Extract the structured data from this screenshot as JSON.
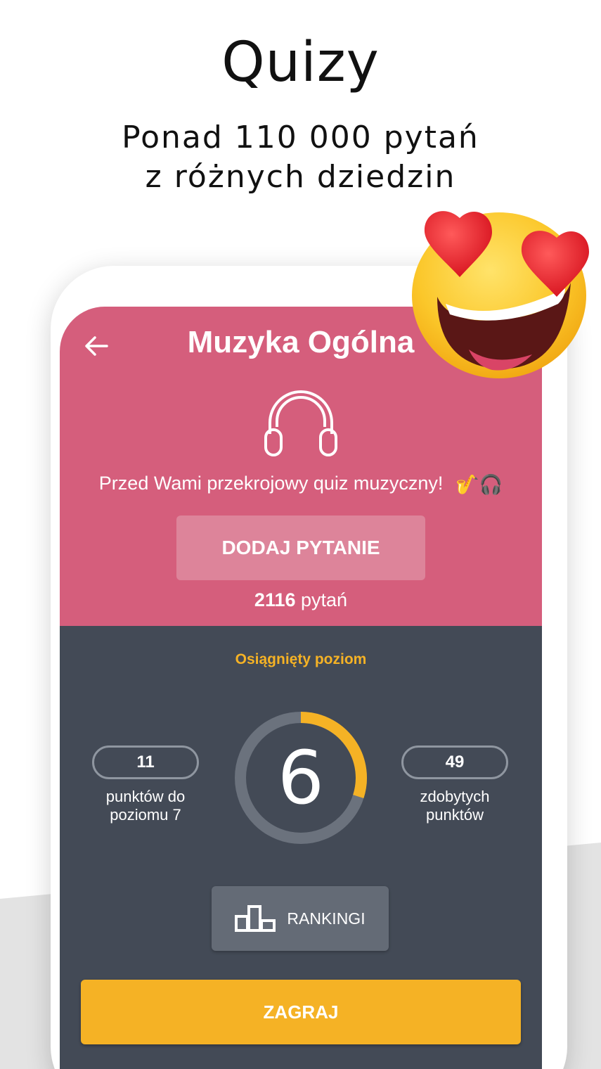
{
  "promo": {
    "title": "Quizy",
    "subtitle_line1": "Ponad 110 000 pytań",
    "subtitle_line2": "z różnych dziedzin"
  },
  "screen": {
    "title": "Muzyka Ogólna",
    "description": "Przed Wami przekrojowy quiz muzyczny!",
    "description_emoji": "🎷🎧",
    "add_question_label": "DODAJ PYTANIE",
    "question_count": "2116",
    "question_count_unit": "pytań"
  },
  "level": {
    "label": "Osiągnięty poziom",
    "value": "6",
    "progress_fraction": 0.3,
    "points_to_next": "11",
    "points_to_next_label_line1": "punktów do",
    "points_to_next_label_line2": "poziomu 7",
    "points_earned": "49",
    "points_earned_label_line1": "zdobytych",
    "points_earned_label_line2": "punktów"
  },
  "actions": {
    "rankings_label": "RANKINGI",
    "play_label": "ZAGRAJ"
  },
  "colors": {
    "header": "#d55e7c",
    "dark_panel": "#434a56",
    "accent": "#f5b225"
  },
  "icons": {
    "back": "arrow-left-icon",
    "category": "headphones-icon",
    "rankings": "podium-icon",
    "decoration": "heart-eyes-emoji-icon"
  }
}
